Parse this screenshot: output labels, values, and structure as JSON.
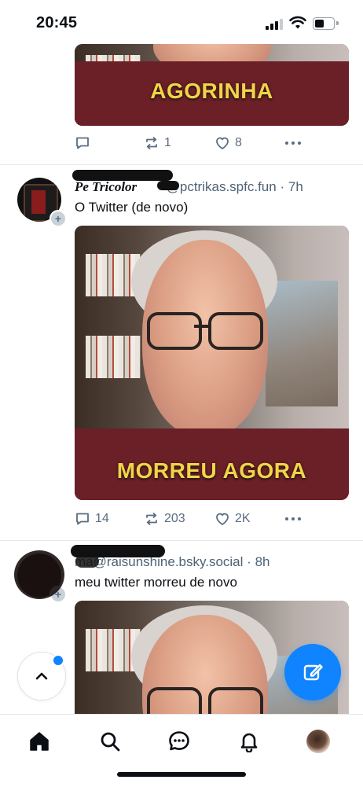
{
  "status_bar": {
    "time": "20:45"
  },
  "feed": {
    "posts": [
      {
        "media_caption": "AGORINHA",
        "replies": "",
        "reposts": "1",
        "likes": "8"
      },
      {
        "display_name": "Pe Tricolor",
        "handle": "@pctrikas.spfc.fun",
        "separator": "·",
        "time_ago": "7h",
        "text": "O Twitter (de novo)",
        "media_caption": "MORREU AGORA",
        "replies": "14",
        "reposts": "203",
        "likes": "2K"
      },
      {
        "handle": "ma@raisunshine.bsky.social",
        "separator": "·",
        "time_ago": "8h",
        "text": "meu twitter morreu de novo"
      }
    ]
  },
  "colors": {
    "accent": "#1083fe",
    "muted": "#5a6d80"
  },
  "icons": {
    "reply": "chat-bubble-icon",
    "repost": "repost-arrows-icon",
    "like": "heart-outline-icon",
    "more": "ellipsis-icon"
  },
  "tabbar": {
    "items": [
      "home-icon",
      "search-icon",
      "chat-icon",
      "bell-icon",
      "profile-avatar"
    ]
  }
}
